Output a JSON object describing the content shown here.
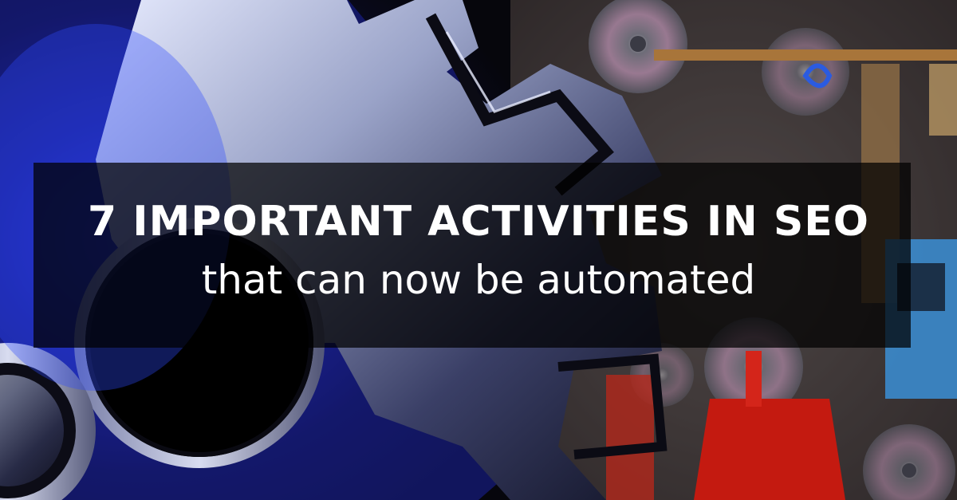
{
  "banner": {
    "headline": "7 IMPORTANT ACTIVITIES IN SEO",
    "subheadline": "that can now be automated"
  }
}
